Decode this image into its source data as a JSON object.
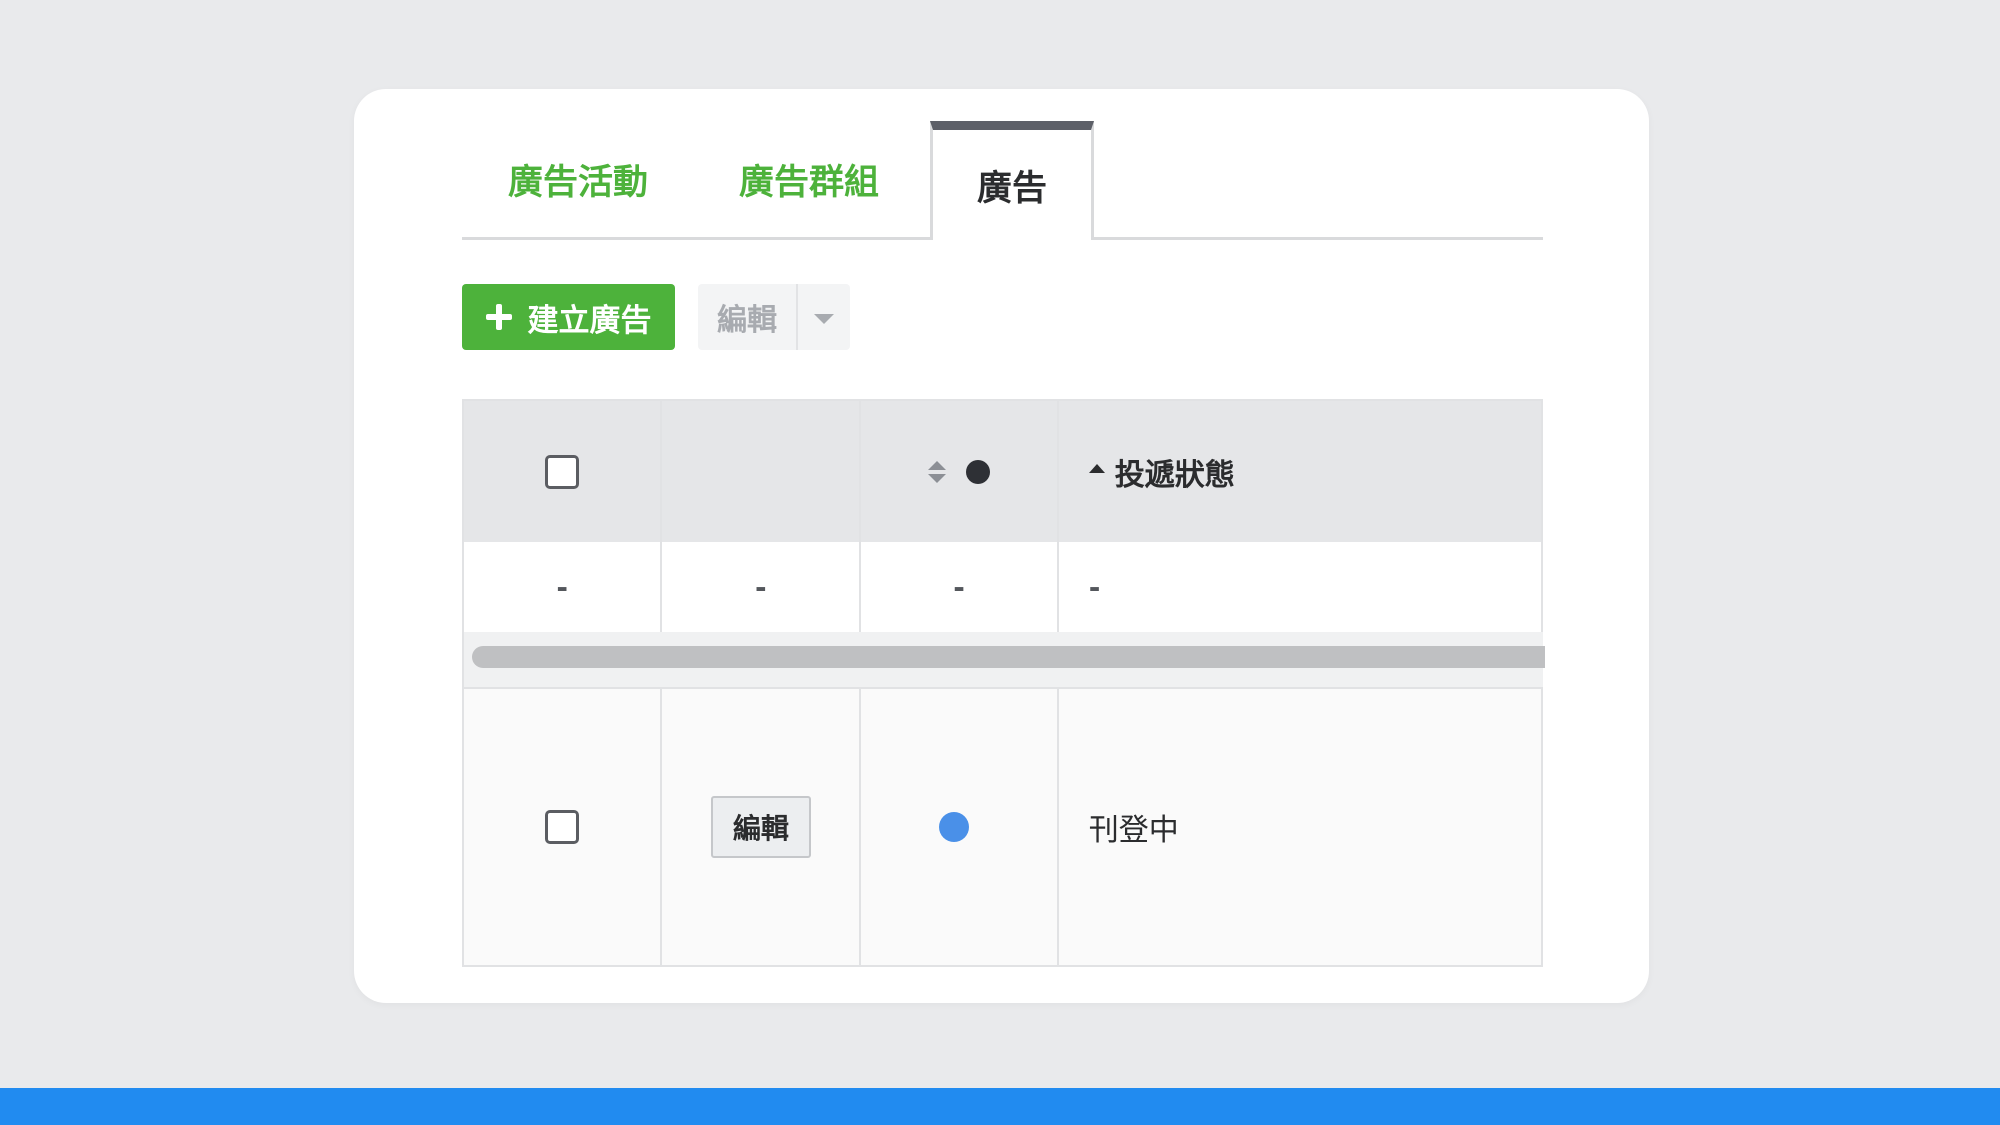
{
  "tabs": [
    {
      "label": "廣告活動",
      "active": false
    },
    {
      "label": "廣告群組",
      "active": false
    },
    {
      "label": "廣告",
      "active": true
    }
  ],
  "toolbar": {
    "create_label": "建立廣告",
    "edit_label": "編輯"
  },
  "table": {
    "header": {
      "status_label": "投遞狀態"
    },
    "summary_row": [
      "-",
      "-",
      "-",
      "-"
    ],
    "rows": [
      {
        "edit_label": "編輯",
        "status": "刊登中",
        "status_color": "#4a90e8"
      }
    ]
  },
  "colors": {
    "accent_green": "#4db23b",
    "bottom_bar_blue": "#218bf0"
  }
}
